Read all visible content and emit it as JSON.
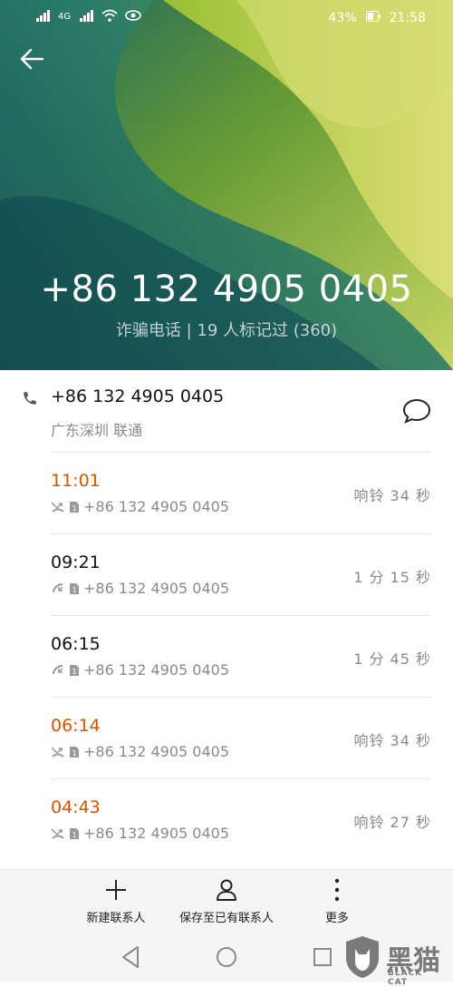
{
  "status_bar": {
    "signal_left": "4G",
    "signal_right": "4G",
    "battery": "43%",
    "time": "21:58"
  },
  "header": {
    "phone_number": "+86 132 4905 0405",
    "tag": "诈骗电话 | 19 人标记过 (360)"
  },
  "contact": {
    "number": "+86 132 4905 0405",
    "location": "广东深圳 联通"
  },
  "calls": [
    {
      "time": "11:01",
      "number": "+86 132 4905 0405",
      "duration": "响铃 34 秒",
      "missed": true
    },
    {
      "time": "09:21",
      "number": "+86 132 4905 0405",
      "duration": "1 分 15 秒",
      "missed": false
    },
    {
      "time": "06:15",
      "number": "+86 132 4905 0405",
      "duration": "1 分 45 秒",
      "missed": false
    },
    {
      "time": "06:14",
      "number": "+86 132 4905 0405",
      "duration": "响铃 34 秒",
      "missed": true
    },
    {
      "time": "04:43",
      "number": "+86 132 4905 0405",
      "duration": "响铃 27 秒",
      "missed": true
    }
  ],
  "toolbar": {
    "new_contact": "新建联系人",
    "save_existing": "保存至已有联系人",
    "more": "更多"
  },
  "watermark": {
    "text": "黑猫",
    "sub": "BLACK CAT"
  },
  "colors": {
    "missed": "#d35400",
    "secondary_text": "#8a8a8a"
  }
}
